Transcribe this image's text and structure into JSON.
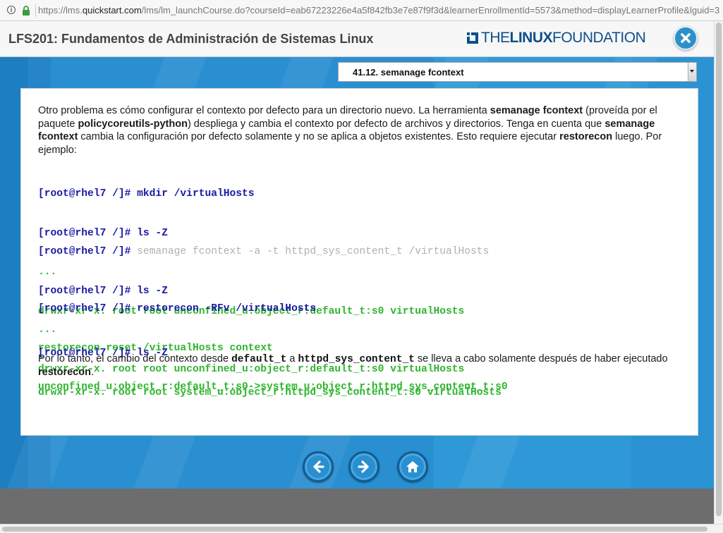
{
  "browser": {
    "url_prefix": "https://lms.",
    "url_host": "quickstart.com",
    "url_rest": "/lms/lm_launchCourse.do?courseId=eab67223226e4a5f842fb3e7e87f9f3d&learnerEnrollmentId=5573&method=displayLearnerProfile&lguid=3"
  },
  "header": {
    "title": "LFS201: Fundamentos de Administración de Sistemas Linux",
    "logo_the": "THE",
    "logo_linux": "LINUX",
    "logo_foundation": "FOUNDATION"
  },
  "topic_select": {
    "selected": "41.12. semanage fcontext"
  },
  "content": {
    "intro": {
      "t1": "Otro problema es cómo configurar el contexto por defecto para un directorio nuevo. La herramienta ",
      "b1": "semanage fcontext",
      "t2": " (proveída por el paquete ",
      "b2": "policycoreutils-python",
      "t3": ") despliega y cambia el contexto por defecto de archivos y directorios. Tenga en cuenta que ",
      "b3": "semanage fcontext",
      "t4": " cambia la configuración por defecto solamente y no se aplica a objetos existentes. Esto requiere ejecutar ",
      "b4": "restorecon",
      "t5": " luego. Por ejemplo:"
    },
    "block1": {
      "cmd1": "[root@rhel7 /]# mkdir /virtualHosts",
      "cmd2": "[root@rhel7 /]# ls -Z",
      "out1": "...",
      "out2": "drwxr-xr-x. root root unconfined_u:object_r:default_t:s0 virtualHosts"
    },
    "block2": {
      "prompt": "[root@rhel7 /]# ",
      "cmd1_faint": "semanage fcontext -a -t httpd_sys_content_t /virtualHosts",
      "cmd2": "[root@rhel7 /]# ls -Z",
      "out1": "...",
      "out2": "drwxr-xr-x. root root unconfined_u:object_r:default_t:s0 virtualHosts"
    },
    "block3": {
      "cmd1": "[root@rhel7 /]# restorecon -RFv /virtualHosts",
      "out1": "restorecon reset /virtualHosts context",
      "out2": "unconfined_u:object_r:default_t:s0->system_u:object_r:httpd_sys_content_t:s0"
    },
    "block4": {
      "cmd1": "[root@rhel7 /]# ls -Z",
      "out1": "drwxr-xr-x. root root system_u:object_r:httpd_sys_content_t:s0 virtualHosts"
    },
    "outro": {
      "t1": "Por lo tanto, el cambio del contexto desde ",
      "c1": "default_t",
      "t2": " a ",
      "c2": "httpd_sys_content_t",
      "t3": " se lleva a cabo solamente después de haber ejecutado ",
      "b1": "restorecon",
      "t4": "."
    }
  },
  "nav": {
    "prev_icon": "arrow-left-icon",
    "next_icon": "arrow-right-icon",
    "home_icon": "home-icon"
  },
  "colors": {
    "stage_blue": "#2a8fd0",
    "command_blue": "#1a1aa6",
    "output_green": "#2fb52f",
    "logo_blue": "#0d4f8b"
  }
}
